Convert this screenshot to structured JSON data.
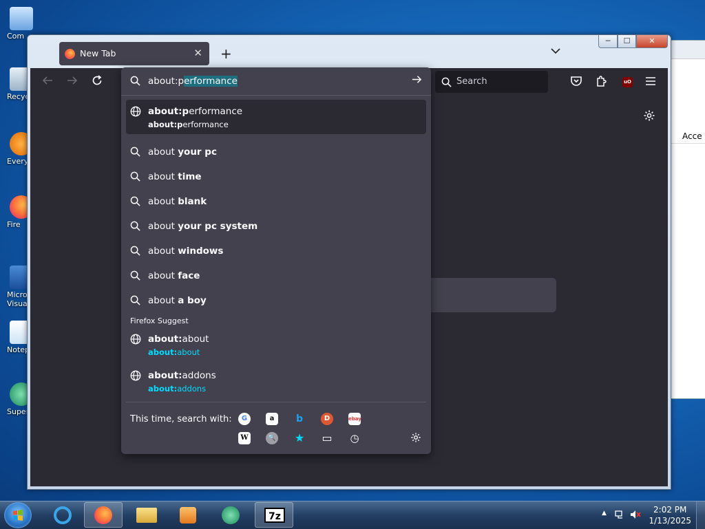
{
  "desktop": {
    "icons": [
      {
        "label": "Com",
        "name": "computer"
      },
      {
        "label": "Recyc",
        "name": "recycle-bin"
      },
      {
        "label": "Every",
        "name": "everything"
      },
      {
        "label": "Fire",
        "name": "firefox"
      },
      {
        "label": "Micro\nVisual",
        "name": "visual-studio"
      },
      {
        "label": "Notep",
        "name": "notepad"
      },
      {
        "label": "Super",
        "name": "super"
      }
    ],
    "bg_window_header": "Acce"
  },
  "firefox": {
    "tab": {
      "title": "New Tab",
      "close": "✕"
    },
    "new_tab": "+",
    "list_tabs": "⌄",
    "window_buttons": {
      "minimize": "─",
      "maximize": "☐",
      "close": "✕"
    },
    "search": {
      "placeholder": "Search"
    },
    "ublock_label": "uO"
  },
  "urlbar": {
    "typed_prefix": "about:p",
    "typed_selection": "erformance",
    "rows": [
      {
        "t1_bold": "about:p",
        "t1_rest": "erformance",
        "t2_bold": "about:p",
        "t2_rest": "erformance",
        "icon": "globe-icon",
        "selected": true
      },
      {
        "prefix": "about ",
        "bold": "your pc",
        "icon": "search-icon"
      },
      {
        "prefix": "about ",
        "bold": "time",
        "icon": "search-icon"
      },
      {
        "prefix": "about ",
        "bold": "blank",
        "icon": "search-icon"
      },
      {
        "prefix": "about ",
        "bold": "your pc system",
        "icon": "search-icon"
      },
      {
        "prefix": "about ",
        "bold": "windows",
        "icon": "search-icon"
      },
      {
        "prefix": "about ",
        "bold": "face",
        "icon": "search-icon"
      },
      {
        "prefix": "about ",
        "bold": "a boy",
        "icon": "search-icon"
      }
    ],
    "suggest_label": "Firefox Suggest",
    "suggest_rows": [
      {
        "t1_bold": "about:",
        "t1_rest": "about",
        "t2_bold": "about:",
        "t2_rest": "about"
      },
      {
        "t1_bold": "about:",
        "t1_rest": "addons",
        "t2_bold": "about:",
        "t2_rest": "addons"
      }
    ],
    "oneoff_label": "This time, search with:",
    "engines": [
      {
        "name": "google",
        "glyph": "G"
      },
      {
        "name": "amazon",
        "glyph": "a"
      },
      {
        "name": "bing",
        "glyph": "b"
      },
      {
        "name": "duckduckgo",
        "glyph": "D"
      },
      {
        "name": "ebay",
        "glyph": "ebay"
      },
      {
        "name": "wikipedia",
        "glyph": "W"
      },
      {
        "name": "other-engine",
        "glyph": "🔍"
      },
      {
        "name": "bookmarks",
        "glyph": "★"
      },
      {
        "name": "tabs",
        "glyph": "▭"
      },
      {
        "name": "history",
        "glyph": "◷"
      }
    ]
  },
  "taskbar": {
    "time": "2:02 PM",
    "date": "1/13/2025",
    "items": [
      "internet-explorer",
      "firefox",
      "file-explorer",
      "media-player",
      "messenger",
      "7zip"
    ],
    "sevenzip_label": "7z"
  }
}
